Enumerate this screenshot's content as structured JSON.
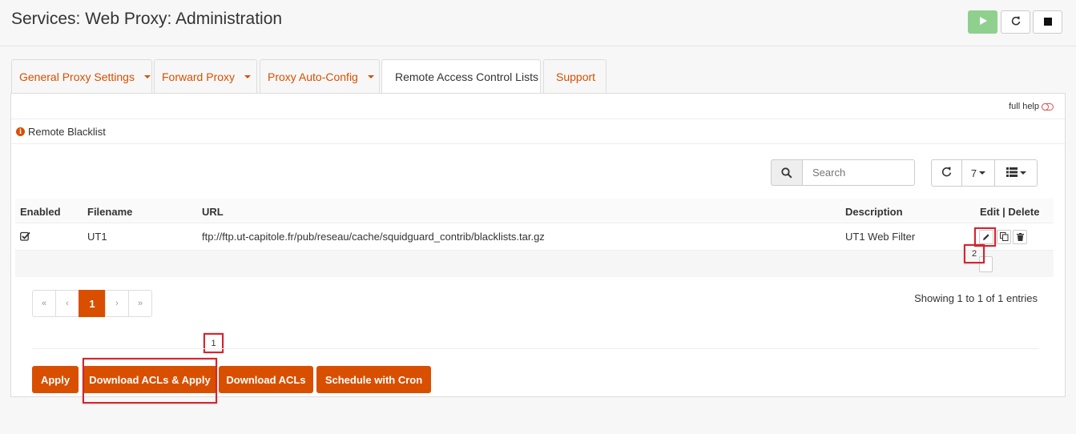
{
  "header": {
    "title": "Services: Web Proxy: Administration"
  },
  "tabs": [
    {
      "label": "General Proxy Settings",
      "has_dropdown": true
    },
    {
      "label": "Forward Proxy",
      "has_dropdown": true
    },
    {
      "label": "Proxy Auto-Config",
      "has_dropdown": true
    },
    {
      "label": "Remote Access Control Lists",
      "active": true
    },
    {
      "label": "Support"
    }
  ],
  "help": {
    "label": "full help"
  },
  "section": {
    "title": "Remote Blacklist"
  },
  "grid": {
    "search_placeholder": "Search",
    "rows_per_page": "7",
    "columns": {
      "enabled": "Enabled",
      "filename": "Filename",
      "url": "URL",
      "description": "Description",
      "actions": "Edit | Delete"
    },
    "rows": [
      {
        "enabled": true,
        "filename": "UT1",
        "url": "ftp://ftp.ut-capitole.fr/pub/reseau/cache/squidguard_contrib/blacklists.tar.gz",
        "description": "UT1 Web Filter"
      }
    ],
    "pagination": {
      "first": "«",
      "prev": "‹",
      "current": "1",
      "next": "›",
      "last": "»"
    },
    "info": "Showing 1 to 1 of 1 entries"
  },
  "annotations": {
    "one": "1",
    "two": "2"
  },
  "actions": {
    "apply": "Apply",
    "download_apply": "Download ACLs & Apply",
    "download": "Download ACLs",
    "schedule": "Schedule with Cron"
  },
  "colors": {
    "accent": "#d94f00",
    "start_green": "#8fd08f",
    "annotation_red": "#d9232e"
  }
}
